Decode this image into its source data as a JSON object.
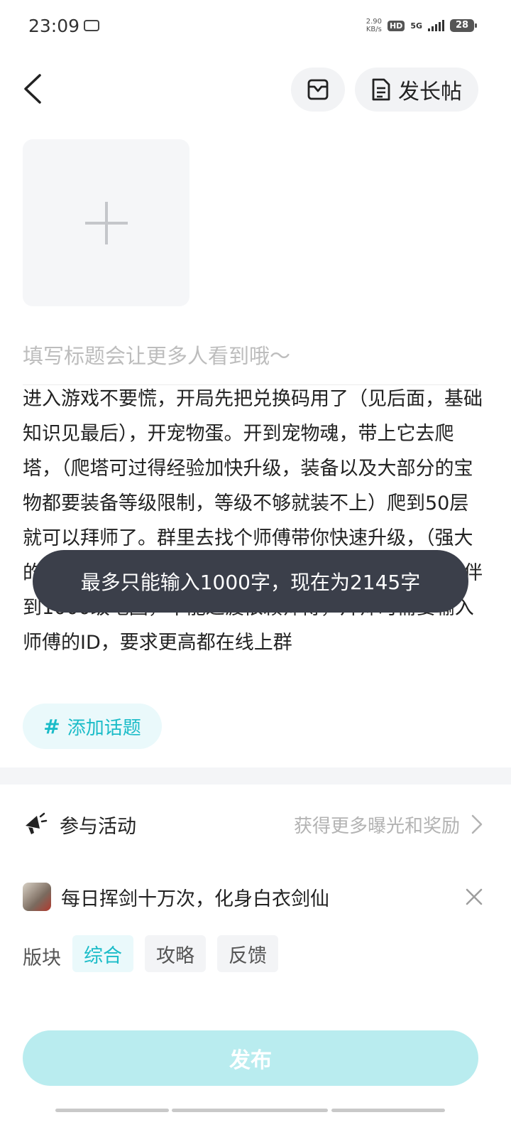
{
  "status_bar": {
    "time": "23:09",
    "speed_value": "2.90",
    "speed_unit": "KB/s",
    "hd_label": "HD",
    "network_label": "5G",
    "battery_level": "28"
  },
  "header": {
    "long_post_label": "发长帖",
    "back_icon": "back-arrow-icon",
    "drafts_icon": "inbox-icon",
    "long_post_icon": "document-icon"
  },
  "composer": {
    "title_placeholder": "填写标题会让更多人看到哦～",
    "body_text": "进入游戏不要慌，开局先把兑换码用了（见后面，基础知识见最后），开宠物蛋。开到宠物魂，带上它去爬塔，（爬塔可过得经验加快升级，装备以及大部分的宝物都要装备等级限制，等级不够就装不上）爬到50层就可以拜师了。群里去找个师傅带你快速升级，（强大的师傅可以带你轻松度过新手期，但师傅只能最高陪伴到1000级地图，不能过渡依赖师傅，拜师时需要输入师傅的ID，要求更高都在线上群"
  },
  "toast": {
    "message": "最多只能输入1000字，现在为2145字"
  },
  "topic": {
    "hash": "#",
    "label": "添加话题"
  },
  "activity": {
    "label": "参与活动",
    "hint": "获得更多曝光和奖励"
  },
  "game": {
    "title": "每日挥剑十万次，化身白衣剑仙"
  },
  "sections": {
    "label": "版块",
    "chips": [
      "综合",
      "攻略",
      "反馈"
    ],
    "selected": "综合"
  },
  "publish": {
    "label": "发布"
  },
  "colors": {
    "accent": "#1bbcc8",
    "publish_disabled": "#b9ecef",
    "toast_bg": "#3b3f4a"
  }
}
